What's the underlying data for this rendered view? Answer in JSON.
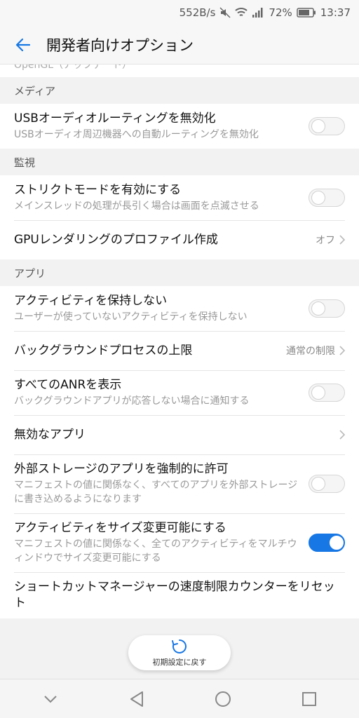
{
  "status_bar": {
    "data_rate": "552B/s",
    "battery": "72%",
    "time": "13:37",
    "icons": [
      "mute-icon",
      "wifi-icon",
      "signal-icon",
      "battery-icon"
    ]
  },
  "app_bar": {
    "title": "開発者向けオプション",
    "back_icon": "back-arrow-icon",
    "accent_color": "#1677e5"
  },
  "cut_row_text": "OpenGL（アップデート）",
  "sections": {
    "media": {
      "header": "メディア",
      "usb_audio": {
        "title": "USBオーディオルーティングを無効化",
        "subtitle": "USBオーディオ周辺機器への自動ルーティングを無効化",
        "enabled": false
      }
    },
    "monitoring": {
      "header": "監視",
      "strict_mode": {
        "title": "ストリクトモードを有効にする",
        "subtitle": "メインスレッドの処理が長引く場合は画面を点滅させる",
        "enabled": false
      },
      "gpu_profile": {
        "title": "GPUレンダリングのプロファイル作成",
        "value": "オフ"
      }
    },
    "apps": {
      "header": "アプリ",
      "dont_keep": {
        "title": "アクティビティを保持しない",
        "subtitle": "ユーザーが使っていないアクティビティを保持しない",
        "enabled": false
      },
      "bg_limit": {
        "title": "バックグラウンドプロセスの上限",
        "value": "通常の制限"
      },
      "show_anr": {
        "title": "すべてのANRを表示",
        "subtitle": "バックグラウンドアプリが応答しない場合に通知する",
        "enabled": false
      },
      "inactive_apps": {
        "title": "無効なアプリ"
      },
      "force_external": {
        "title": "外部ストレージのアプリを強制的に許可",
        "subtitle": "マニフェストの値に関係なく、すべてのアプリを外部ストレージに書き込めるようになります",
        "enabled": false
      },
      "resizable": {
        "title": "アクティビティをサイズ変更可能にする",
        "subtitle": "マニフェストの値に関係なく、全てのアクティビティをマルチウィンドウでサイズ変更可能にする",
        "enabled": true
      },
      "shortcut_reset": {
        "title": "ショートカットマネージャーの速度制限カウンターをリセット"
      }
    }
  },
  "reset_button": {
    "label": "初期設定に戻す",
    "icon": "refresh-icon"
  },
  "nav_bar": {
    "icons": [
      "chevron-down-icon",
      "back-triangle-icon",
      "home-circle-icon",
      "recents-square-icon"
    ]
  }
}
